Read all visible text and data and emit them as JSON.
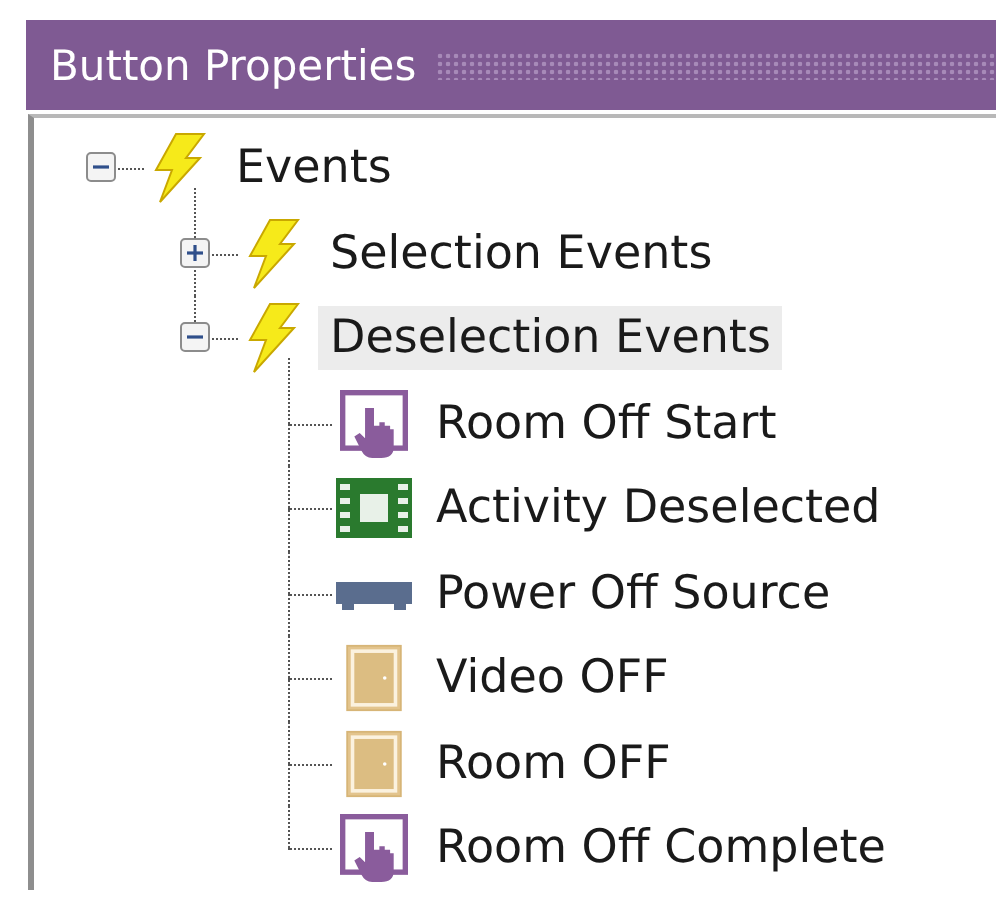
{
  "panel": {
    "title": "Button Properties"
  },
  "tree": [
    {
      "label": "Events",
      "kind": "event",
      "expanded": true,
      "selected": false,
      "children": [
        {
          "label": "Selection Events",
          "kind": "event",
          "expanded": false,
          "selected": false
        },
        {
          "label": "Deselection Events",
          "kind": "event",
          "expanded": true,
          "selected": true,
          "children": [
            {
              "label": "Room Off Start",
              "kind": "touch",
              "selected": false
            },
            {
              "label": "Activity Deselected",
              "kind": "activity",
              "selected": false
            },
            {
              "label": "Power Off Source",
              "kind": "device",
              "selected": false
            },
            {
              "label": "Video OFF",
              "kind": "door",
              "selected": false
            },
            {
              "label": "Room OFF",
              "kind": "door",
              "selected": false
            },
            {
              "label": "Room Off Complete",
              "kind": "touch",
              "selected": false
            }
          ]
        }
      ]
    }
  ]
}
